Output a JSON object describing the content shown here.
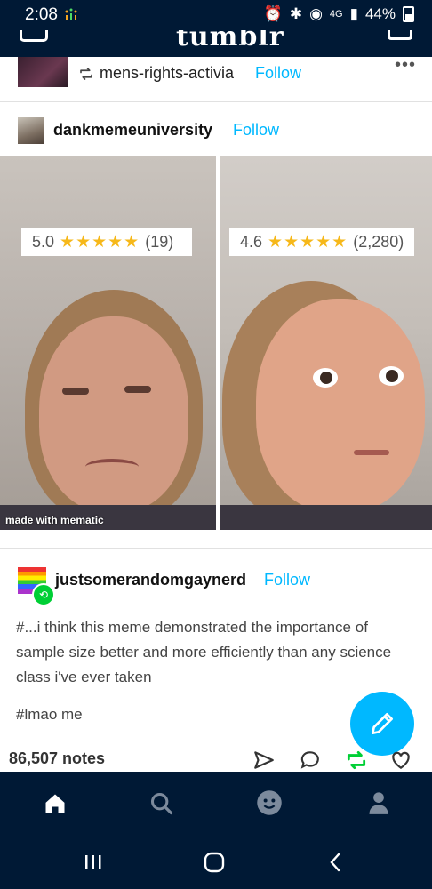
{
  "status_bar": {
    "time": "2:08",
    "network": "4G",
    "battery": "44%"
  },
  "app": {
    "logo": "tumblr"
  },
  "reblog_row": {
    "username": "mens-rights-activia",
    "follow_label": "Follow",
    "more_label": "•••"
  },
  "post": {
    "author": "dankmemeuniversity",
    "follow_label": "Follow",
    "image": {
      "left_rating": {
        "score": "5.0",
        "stars": "★★★★★",
        "count": "(19)"
      },
      "right_rating": {
        "score": "4.6",
        "stars": "★★★★★",
        "count": "(2,280)"
      },
      "watermark": "made with mematic"
    }
  },
  "reblogger": {
    "author": "justsomerandomgaynerd",
    "follow_label": "Follow",
    "caption": "#...i think this meme demonstrated the importance of sample size better and more efficiently than any science class i've ever taken",
    "tag": "#lmao me"
  },
  "footer": {
    "notes": "86,507 notes"
  },
  "colors": {
    "nav_bg": "#001935",
    "accent": "#00b8ff",
    "reblog_green": "#00cf35",
    "star": "#f6b81a"
  },
  "icons": {
    "share": "send-icon",
    "reply": "speech-bubble-icon",
    "reblog": "reblog-icon",
    "like": "heart-icon",
    "home": "home-icon",
    "search": "search-icon",
    "activity": "smiley-icon",
    "account": "person-icon"
  }
}
